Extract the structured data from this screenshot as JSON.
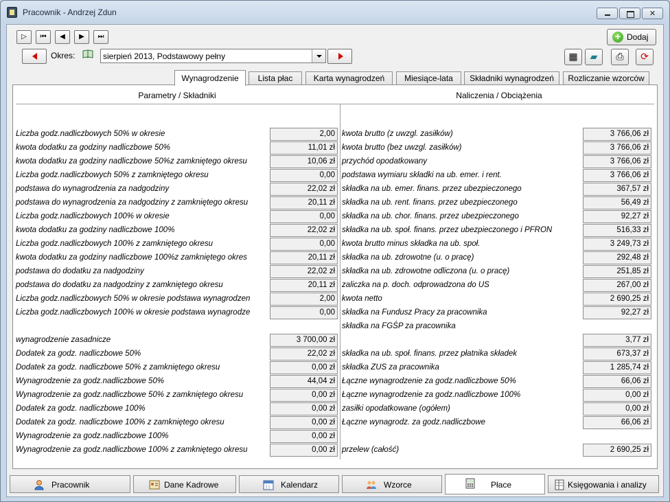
{
  "window": {
    "title": "Pracownik - Andrzej Zdun"
  },
  "toolbar": {
    "add_label": "Dodaj"
  },
  "period": {
    "label": "Okres:",
    "value": "sierpień 2013, Podstawowy pełny"
  },
  "tabs": [
    {
      "label": "Wynagrodzenie",
      "active": true
    },
    {
      "label": "Lista płac"
    },
    {
      "label": "Karta wynagrodzeń"
    },
    {
      "label": "Miesiące-lata"
    },
    {
      "label": "Składniki wynagrodzeń"
    },
    {
      "label": "Rozliczanie wzorców"
    }
  ],
  "left_header": "Parametry / Składniki",
  "right_header": "Naliczenia / Obciążenia",
  "left_rows": [
    {
      "label": "Liczba godz.nadliczbowych 50% w okresie",
      "value": "2,00"
    },
    {
      "label": "kwota dodatku za godziny nadliczbowe 50%",
      "value": "11,01 zł"
    },
    {
      "label": "kwota dodatku za godziny nadliczbowe 50%z zamkniętego okresu",
      "value": "10,06 zł"
    },
    {
      "label": "Liczba godz.nadliczbowych 50% z zamkniętego okresu",
      "value": "0,00"
    },
    {
      "label": "podstawa do wynagrodzenia za nadgodziny",
      "value": "22,02 zł"
    },
    {
      "label": "podstawa do wynagrodzenia za nadgodziny z zamkniętego okresu",
      "value": "20,11 zł"
    },
    {
      "label": "Liczba godz.nadliczbowych 100% w okresie",
      "value": "0,00"
    },
    {
      "label": "kwota dodatku za godziny nadliczbowe 100%",
      "value": "22,02 zł"
    },
    {
      "label": "Liczba godz.nadliczbowych 100% z zamkniętego okresu",
      "value": "0,00"
    },
    {
      "label": "kwota dodatku za godziny nadliczbowe 100%z zamkniętego okres",
      "value": "20,11 zł"
    },
    {
      "label": "podstawa do dodatku za nadgodziny",
      "value": "22,02 zł"
    },
    {
      "label": "podstawa do dodatku za nadgodziny z zamkniętego okresu",
      "value": "20,11 zł"
    },
    {
      "label": "Liczba godz.nadliczbowych 50% w okresie podstawa wynagrodzen",
      "value": "2,00"
    },
    {
      "label": "Liczba godz.nadliczbowych 100% w okresie podstawa wynagrodze",
      "value": "0,00"
    },
    {
      "label": "",
      "value": ""
    },
    {
      "label": "wynagrodzenie zasadnicze",
      "value": "3 700,00 zł"
    },
    {
      "label": "Dodatek za godz. nadliczbowe 50%",
      "value": "22,02 zł"
    },
    {
      "label": "Dodatek za godz. nadliczbowe 50% z zamkniętego okresu",
      "value": "0,00 zł"
    },
    {
      "label": "Wynagrodzenie za godz.nadliczbowe 50%",
      "value": "44,04 zł"
    },
    {
      "label": "Wynagrodzenie za godz.nadliczbowe 50% z zamkniętego okresu",
      "value": "0,00 zł"
    },
    {
      "label": "Dodatek za godz. nadliczbowe 100%",
      "value": "0,00 zł"
    },
    {
      "label": "Dodatek za godz. nadliczbowe 100% z zamkniętego okresu",
      "value": "0,00 zł"
    },
    {
      "label": "Wynagrodzenie za godz.nadliczbowe 100%",
      "value": "0,00 zł"
    },
    {
      "label": "Wynagrodzenie za godz.nadliczbowe 100% z zamkniętego okresu",
      "value": "0,00 zł"
    }
  ],
  "right_rows": [
    {
      "label": "kwota brutto (z uwzgl. zasiłków)",
      "value": "3 766,06 zł"
    },
    {
      "label": "kwota brutto (bez uwzgl. zasiłków)",
      "value": "3 766,06 zł"
    },
    {
      "label": "przychód opodatkowany",
      "value": "3 766,06 zł"
    },
    {
      "label": "podstawa wymiaru składki na ub. emer. i rent.",
      "value": "3 766,06 zł"
    },
    {
      "label": "składka na ub. emer. finans. przez ubezpieczonego",
      "value": "367,57 zł"
    },
    {
      "label": "składka na ub. rent. finans. przez ubezpieczonego",
      "value": "56,49 zł"
    },
    {
      "label": "składka na ub. chor. finans. przez ubezpieczonego",
      "value": "92,27 zł"
    },
    {
      "label": "składka na ub. społ. finans. przez ubezpieczonego i PFRON",
      "value": "516,33 zł"
    },
    {
      "label": "kwota brutto minus składka na ub. społ.",
      "value": "3 249,73 zł"
    },
    {
      "label": "składka na ub. zdrowotne (u. o pracę)",
      "value": "292,48 zł"
    },
    {
      "label": "składka na ub. zdrowotne odliczona (u. o pracę)",
      "value": "251,85 zł"
    },
    {
      "label": "zaliczka na p. doch. odprowadzona do US",
      "value": "267,00 zł"
    },
    {
      "label": "kwota netto",
      "value": "2 690,25 zł"
    },
    {
      "label": "składka na Fundusz Pracy za pracownika",
      "value": "92,27 zł"
    },
    {
      "label": "składka na FGŚP za pracownika",
      "value": ""
    },
    {
      "label": "",
      "value": "3,77 zł"
    },
    {
      "label": "składka na ub. społ. finans. przez płatnika składek",
      "value": "673,37 zł"
    },
    {
      "label": "składka ZUS za pracownika",
      "value": "1 285,74 zł"
    },
    {
      "label": "Łączne wynagrodzenie za godz.nadliczbowe 50%",
      "value": "66,06 zł"
    },
    {
      "label": "Łączne wynagrodzenie za godz.nadliczbowe 100%",
      "value": "0,00 zł"
    },
    {
      "label": "zasiłki opodatkowane (ogółem)",
      "value": "0,00 zł"
    },
    {
      "label": "Łączne wynagrodz. za godz.nadliczbowe",
      "value": "66,06 zł"
    },
    {
      "label": "",
      "value": ""
    },
    {
      "label": "przelew (całość)",
      "value": "2 690,25 zł"
    }
  ],
  "bottom_tabs": [
    {
      "label": "Pracownik",
      "icon": "person-icon"
    },
    {
      "label": "Dane Kadrowe",
      "icon": "id-card-icon"
    },
    {
      "label": "Kalendarz",
      "icon": "calendar-icon"
    },
    {
      "label": "Wzorce",
      "icon": "people-icon"
    },
    {
      "label": "Płace",
      "icon": "calculator-icon",
      "active": true
    },
    {
      "label": "Księgowania i analizy",
      "icon": "ledger-icon"
    }
  ],
  "colors": {
    "accent_red": "#d40000",
    "add_green": "#2f9a1c"
  }
}
